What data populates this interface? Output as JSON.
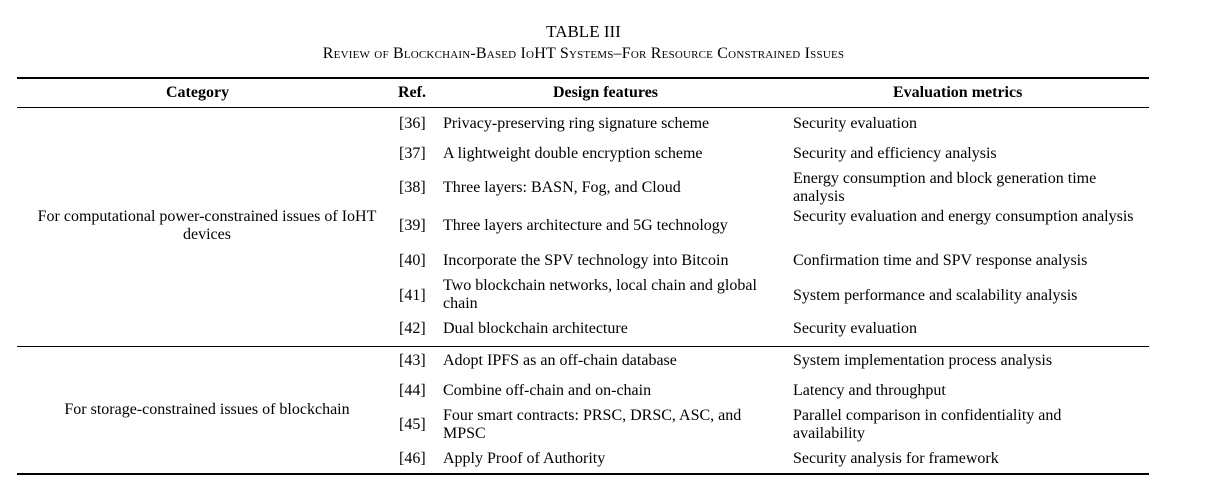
{
  "table": {
    "number": "TABLE III",
    "title": "Review of Blockchain-Based IoHT Systems–For Resource Constrained Issues",
    "headers": {
      "category": "Category",
      "ref": "Ref.",
      "design": "Design features",
      "metrics": "Evaluation metrics"
    },
    "groups": [
      {
        "category": "For computational power-constrained issues of IoHT devices",
        "rows": [
          {
            "ref": "[36]",
            "design": "Privacy-preserving ring signature scheme",
            "metrics": "Security evaluation"
          },
          {
            "ref": "[37]",
            "design": "A lightweight double encryption scheme",
            "metrics": "Security and efficiency analysis"
          },
          {
            "ref": "[38]",
            "design": "Three layers: BASN, Fog, and Cloud",
            "metrics": "Energy consumption and block generation time analysis"
          },
          {
            "ref": "[39]",
            "design": "Three layers architecture and 5G technology",
            "metrics": "Security evaluation and energy consumption analysis"
          },
          {
            "ref": "[40]",
            "design": "Incorporate the SPV technology into Bitcoin",
            "metrics": "Confirmation time and SPV response analysis"
          },
          {
            "ref": "[41]",
            "design": "Two blockchain networks, local chain and global chain",
            "metrics": "System performance and scalability analysis"
          },
          {
            "ref": "[42]",
            "design": "Dual blockchain architecture",
            "metrics": "Security evaluation"
          }
        ]
      },
      {
        "category": "For storage-constrained issues of blockchain",
        "rows": [
          {
            "ref": "[43]",
            "design": "Adopt IPFS as an off-chain database",
            "metrics": "System implementation process analysis"
          },
          {
            "ref": "[44]",
            "design": "Combine off-chain and on-chain",
            "metrics": "Latency and throughput"
          },
          {
            "ref": "[45]",
            "design": "Four smart contracts: PRSC, DRSC, ASC, and MPSC",
            "metrics": "Parallel comparison in confidentiality and availability"
          },
          {
            "ref": "[46]",
            "design": "Apply Proof of Authority",
            "metrics": "Security analysis for framework"
          }
        ]
      }
    ]
  }
}
